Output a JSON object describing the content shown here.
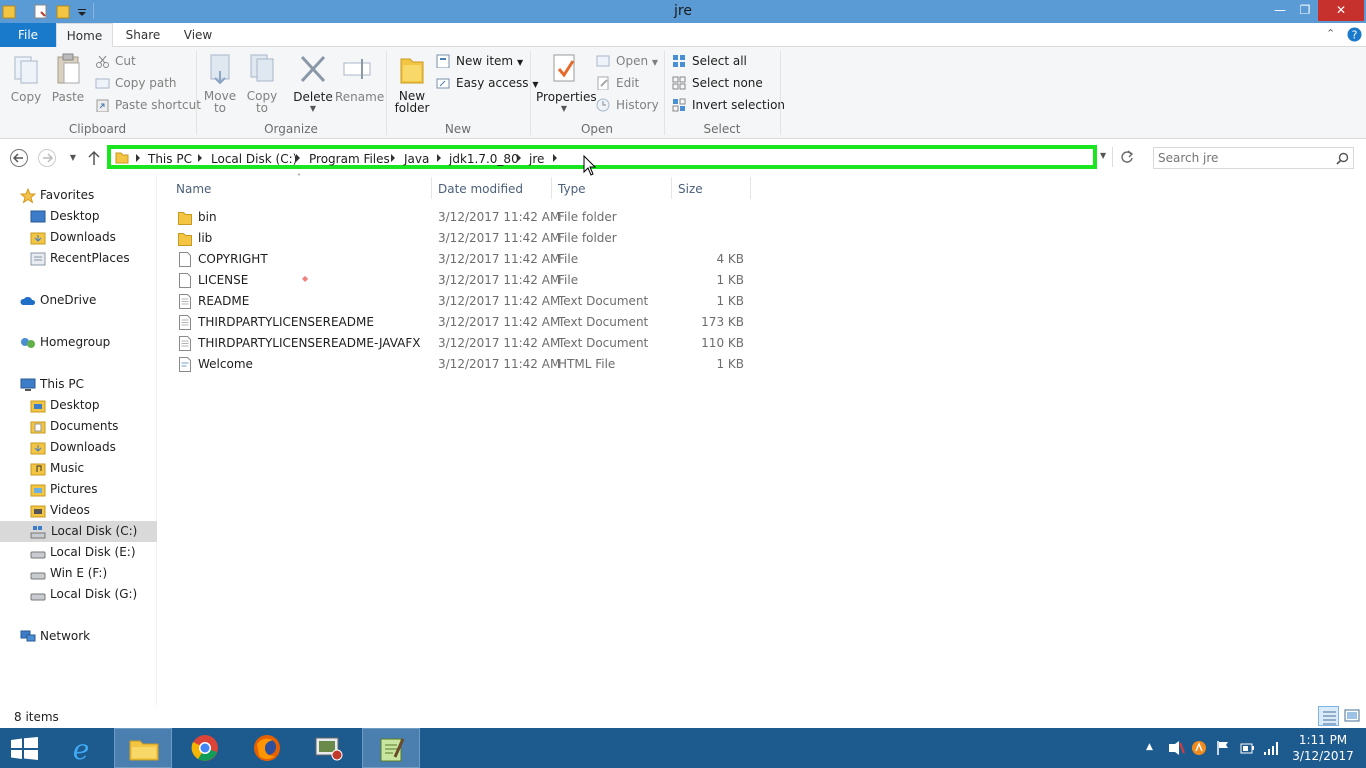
{
  "window": {
    "title": "jre"
  },
  "tabs": {
    "file": "File",
    "home": "Home",
    "share": "Share",
    "view": "View"
  },
  "ribbon": {
    "clipboard": {
      "label": "Clipboard",
      "copy": "Copy",
      "paste": "Paste",
      "cut": "Cut",
      "copy_path": "Copy path",
      "paste_shortcut": "Paste shortcut"
    },
    "organize": {
      "label": "Organize",
      "move_to": "Move",
      "move_to_2": "to",
      "copy_to": "Copy",
      "copy_to_2": "to",
      "delete": "Delete",
      "rename": "Rename"
    },
    "new": {
      "label": "New",
      "new_folder": "New",
      "new_folder_2": "folder",
      "new_item": "New item",
      "easy_access": "Easy access"
    },
    "open": {
      "label": "Open",
      "properties": "Properties",
      "open": "Open",
      "edit": "Edit",
      "history": "History"
    },
    "select": {
      "label": "Select",
      "select_all": "Select all",
      "select_none": "Select none",
      "invert": "Invert selection"
    }
  },
  "address": {
    "crumbs": [
      "This PC",
      "Local Disk (C:)",
      "Program Files",
      "Java",
      "jdk1.7.0_80",
      "jre"
    ]
  },
  "search": {
    "placeholder": "Search jre"
  },
  "nav": {
    "favorites": "Favorites",
    "fav_items": [
      "Desktop",
      "Downloads",
      "RecentPlaces"
    ],
    "onedrive": "OneDrive",
    "homegroup": "Homegroup",
    "thispc": "This PC",
    "pc_items": [
      "Desktop",
      "Documents",
      "Downloads",
      "Music",
      "Pictures",
      "Videos",
      "Local Disk (C:)",
      "Local Disk (E:)",
      "Win E (F:)",
      "Local Disk (G:)"
    ],
    "network": "Network"
  },
  "columns": {
    "name": "Name",
    "date": "Date modified",
    "type": "Type",
    "size": "Size"
  },
  "files": [
    {
      "name": "bin",
      "date": "3/12/2017 11:42 AM",
      "type": "File folder",
      "size": "",
      "icon": "folder-icon"
    },
    {
      "name": "lib",
      "date": "3/12/2017 11:42 AM",
      "type": "File folder",
      "size": "",
      "icon": "folder-icon"
    },
    {
      "name": "COPYRIGHT",
      "date": "3/12/2017 11:42 AM",
      "type": "File",
      "size": "4 KB",
      "icon": "file-icon"
    },
    {
      "name": "LICENSE",
      "date": "3/12/2017 11:42 AM",
      "type": "File",
      "size": "1 KB",
      "icon": "file-icon"
    },
    {
      "name": "README",
      "date": "3/12/2017 11:42 AM",
      "type": "Text Document",
      "size": "1 KB",
      "icon": "text-file-icon"
    },
    {
      "name": "THIRDPARTYLICENSEREADME",
      "date": "3/12/2017 11:42 AM",
      "type": "Text Document",
      "size": "173 KB",
      "icon": "text-file-icon"
    },
    {
      "name": "THIRDPARTYLICENSEREADME-JAVAFX",
      "date": "3/12/2017 11:42 AM",
      "type": "Text Document",
      "size": "110 KB",
      "icon": "text-file-icon"
    },
    {
      "name": "Welcome",
      "date": "3/12/2017 11:42 AM",
      "type": "HTML File",
      "size": "1 KB",
      "icon": "html-file-icon"
    }
  ],
  "status": {
    "item_count": "8 items"
  },
  "clock": {
    "time": "1:11 PM",
    "date": "3/12/2017"
  },
  "colors": {
    "title_bar": "#5b9bd5",
    "file_tab": "#1979ca",
    "highlight_box": "#1ae61f",
    "taskbar": "#1d5a8e",
    "close_button": "#c7312d"
  }
}
